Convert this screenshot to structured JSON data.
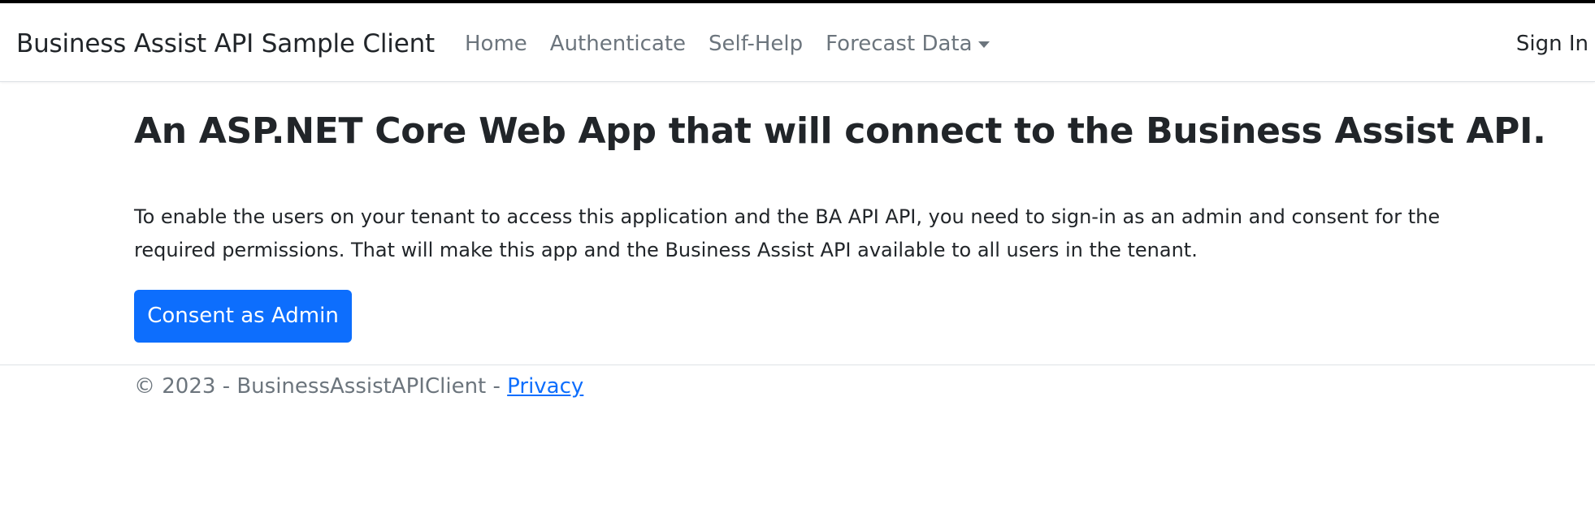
{
  "navbar": {
    "brand": "Business Assist API Sample Client",
    "links": [
      {
        "label": "Home"
      },
      {
        "label": "Authenticate"
      },
      {
        "label": "Self-Help"
      },
      {
        "label": "Forecast Data"
      }
    ],
    "sign_in": "Sign In"
  },
  "main": {
    "heading": "An ASP.NET Core Web App that will connect to the Business Assist API.",
    "paragraph": "To enable the users on your tenant to access this application and the BA API API, you need to sign-in as an admin and consent for the required permissions. That will make this app and the Business Assist API available to all users in the tenant.",
    "consent_button": "Consent as Admin"
  },
  "footer": {
    "copyright": "© 2023 - BusinessAssistAPIClient - ",
    "privacy_link": "Privacy"
  },
  "colors": {
    "primary": "#0d6efd",
    "muted": "#6c757d",
    "text": "#212529"
  }
}
